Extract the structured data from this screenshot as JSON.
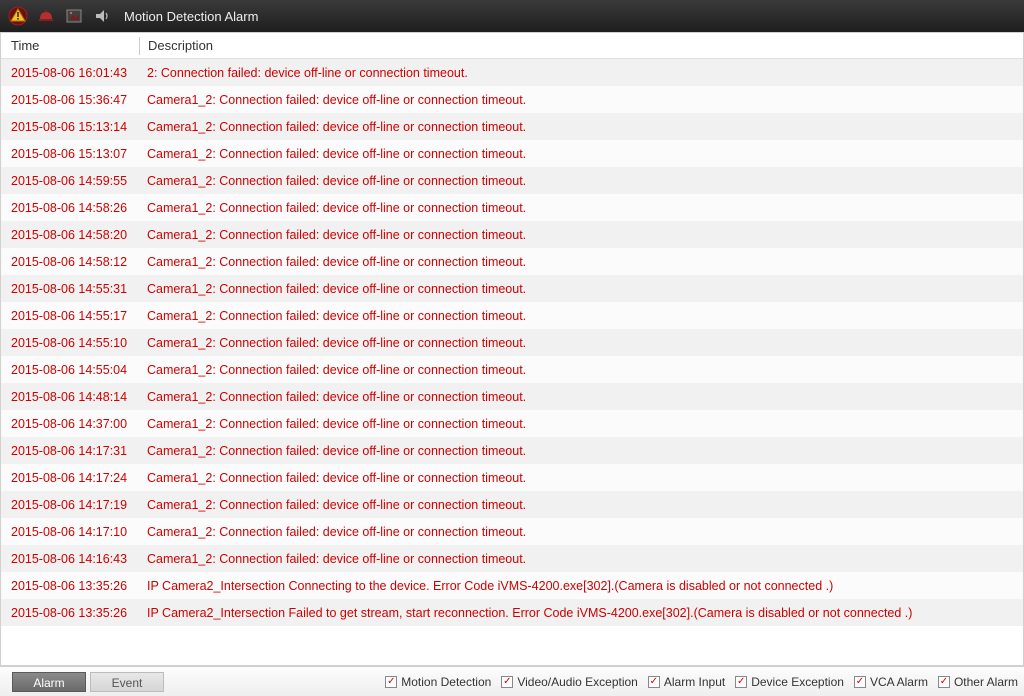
{
  "header": {
    "title": "Motion Detection Alarm"
  },
  "columns": {
    "time": "Time",
    "description": "Description"
  },
  "events": [
    {
      "time": "2015-08-06 16:01:43",
      "desc": "2: Connection failed: device off-line or connection timeout."
    },
    {
      "time": "2015-08-06 15:36:47",
      "desc": "Camera1_2: Connection failed: device off-line or connection timeout."
    },
    {
      "time": "2015-08-06 15:13:14",
      "desc": "Camera1_2: Connection failed: device off-line or connection timeout."
    },
    {
      "time": "2015-08-06 15:13:07",
      "desc": "Camera1_2: Connection failed: device off-line or connection timeout."
    },
    {
      "time": "2015-08-06 14:59:55",
      "desc": "Camera1_2: Connection failed: device off-line or connection timeout."
    },
    {
      "time": "2015-08-06 14:58:26",
      "desc": "Camera1_2: Connection failed: device off-line or connection timeout."
    },
    {
      "time": "2015-08-06 14:58:20",
      "desc": "Camera1_2: Connection failed: device off-line or connection timeout."
    },
    {
      "time": "2015-08-06 14:58:12",
      "desc": "Camera1_2: Connection failed: device off-line or connection timeout."
    },
    {
      "time": "2015-08-06 14:55:31",
      "desc": "Camera1_2: Connection failed: device off-line or connection timeout."
    },
    {
      "time": "2015-08-06 14:55:17",
      "desc": "Camera1_2: Connection failed: device off-line or connection timeout."
    },
    {
      "time": "2015-08-06 14:55:10",
      "desc": "Camera1_2: Connection failed: device off-line or connection timeout."
    },
    {
      "time": "2015-08-06 14:55:04",
      "desc": "Camera1_2: Connection failed: device off-line or connection timeout."
    },
    {
      "time": "2015-08-06 14:48:14",
      "desc": "Camera1_2: Connection failed: device off-line or connection timeout."
    },
    {
      "time": "2015-08-06 14:37:00",
      "desc": "Camera1_2: Connection failed: device off-line or connection timeout."
    },
    {
      "time": "2015-08-06 14:17:31",
      "desc": "Camera1_2: Connection failed: device off-line or connection timeout."
    },
    {
      "time": "2015-08-06 14:17:24",
      "desc": "Camera1_2: Connection failed: device off-line or connection timeout."
    },
    {
      "time": "2015-08-06 14:17:19",
      "desc": "Camera1_2: Connection failed: device off-line or connection timeout."
    },
    {
      "time": "2015-08-06 14:17:10",
      "desc": "Camera1_2: Connection failed: device off-line or connection timeout."
    },
    {
      "time": "2015-08-06 14:16:43",
      "desc": "Camera1_2: Connection failed: device off-line or connection timeout."
    },
    {
      "time": "2015-08-06 13:35:26",
      "desc": "IP Camera2_Intersection Connecting to the device. Error Code iVMS-4200.exe[302].(Camera is disabled or not connected .)"
    },
    {
      "time": "2015-08-06 13:35:26",
      "desc": "IP Camera2_Intersection Failed to get stream, start reconnection. Error Code iVMS-4200.exe[302].(Camera is disabled or not connected .)"
    }
  ],
  "footer": {
    "tabs": {
      "alarm": "Alarm",
      "event": "Event"
    },
    "filters": {
      "motion_detection": "Motion Detection",
      "video_audio_exception": "Video/Audio Exception",
      "alarm_input": "Alarm Input",
      "device_exception": "Device Exception",
      "vca_alarm": "VCA Alarm",
      "other_alarm": "Other Alarm"
    }
  }
}
